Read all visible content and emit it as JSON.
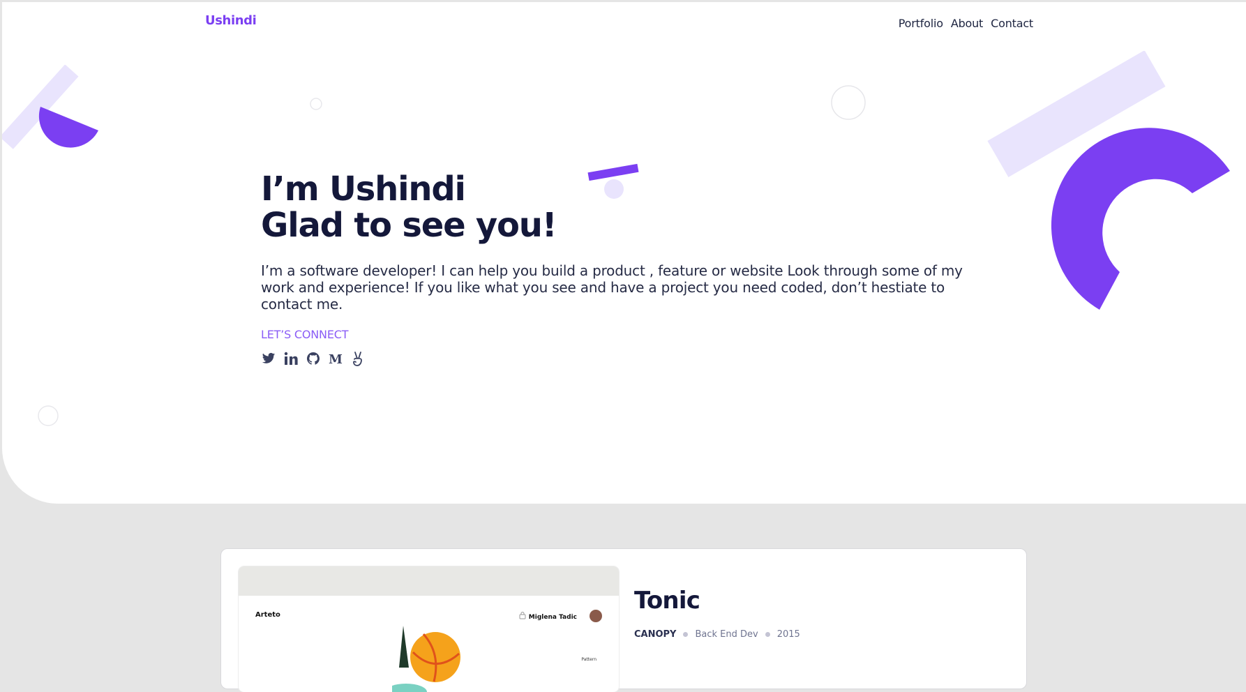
{
  "header": {
    "logo": "Ushindi",
    "nav": [
      "Portfolio",
      "About",
      "Contact"
    ]
  },
  "hero": {
    "line1": "I’m Ushindi",
    "line2": "Glad to see you!",
    "intro": "I’m a software developer! I can help you build a product , feature or website Look through some of my work and experience! If you like what you see and have a project you need coded, don’t hestiate to contact me.",
    "connect_label": "LET’S CONNECT",
    "socials": [
      "twitter-icon",
      "linkedin-icon",
      "github-icon",
      "medium-icon",
      "angellist-icon"
    ]
  },
  "project": {
    "title": "Tonic",
    "company": "CANOPY",
    "role": "Back End Dev",
    "year": "2015",
    "preview": {
      "brand": "Arteto",
      "user": "Miglena Tadic",
      "tag": "Pattern"
    }
  },
  "colors": {
    "accent": "#7b3ff2",
    "accent_light": "#e9e4fd",
    "heading": "#14183a",
    "background": "#e5e5e5"
  }
}
